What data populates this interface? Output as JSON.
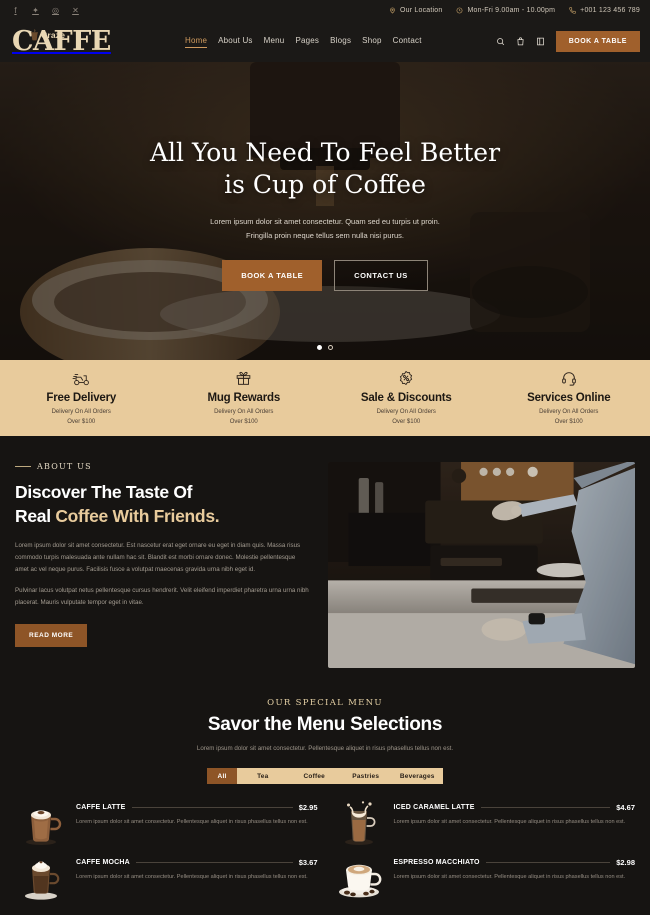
{
  "topbar": {
    "socials": [
      {
        "name": "facebook-icon",
        "glyph": "f"
      },
      {
        "name": "twitter-icon",
        "glyph": "✦"
      },
      {
        "name": "instagram-icon",
        "glyph": "◎"
      },
      {
        "name": "x-icon",
        "glyph": "✕"
      }
    ],
    "location": "Our Location",
    "hours": "Mon-Fri 9.00am - 10.00pm",
    "phone": "+001 123 456 789"
  },
  "header": {
    "logo_main": "AFFE",
    "logo_initial": "C",
    "logo_small": "Craze",
    "nav": [
      {
        "label": "Home",
        "active": true
      },
      {
        "label": "About Us",
        "active": false
      },
      {
        "label": "Menu",
        "active": false
      },
      {
        "label": "Pages",
        "active": false
      },
      {
        "label": "Blogs",
        "active": false
      },
      {
        "label": "Shop",
        "active": false
      },
      {
        "label": "Contact",
        "active": false
      }
    ],
    "book_button": "BOOK A TABLE"
  },
  "hero": {
    "title_line1": "All You Need To Feel Better",
    "title_line2": "is Cup of Coffee",
    "description": "Lorem ipsum dolor sit amet consectetur. Quam sed eu turpis ut proin. Fringilla proin neque tellus sem nulla nisi purus.",
    "primary_button": "BOOK A TABLE",
    "secondary_button": "CONTACT US",
    "slides": 2,
    "active_slide": 1
  },
  "features": [
    {
      "icon": "scooter-delivery-icon",
      "title": "Free Delivery",
      "line1": "Delivery On All Orders",
      "line2": "Over $100"
    },
    {
      "icon": "gift-box-icon",
      "title": "Mug Rewards",
      "line1": "Delivery On All Orders",
      "line2": "Over $100"
    },
    {
      "icon": "discount-badge-icon",
      "title": "Sale & Discounts",
      "line1": "Delivery On All Orders",
      "line2": "Over $100"
    },
    {
      "icon": "headset-icon",
      "title": "Services Online",
      "line1": "Delivery On All Orders",
      "line2": "Over $100"
    }
  ],
  "about": {
    "eyebrow": "ABOUT US",
    "title_line1": "Discover The Taste Of",
    "title_line2_plain": "Real ",
    "title_line2_gold": "Coffee With Friends.",
    "paragraph1": "Lorem ipsum dolor sit amet consectetur. Est nascetur erat eget ornare eu eget in diam quis. Massa risus commodo turpis malesuada ante nullam hac sit. Blandit est morbi ornare donec. Molestie pellentesque amet ac vel neque purus. Facilisis fusce a volutpat maecenas gravida urna nibh eget id.",
    "paragraph2": "Pulvinar lacus volutpat netus pellentesque cursus hendrerit. Velit eleifend imperdiet pharetra urna urna nibh placerat. Mauris vulputate tempor eget in vitae.",
    "read_more": "READ MORE",
    "image_alt": "barista-espresso-machine"
  },
  "menu_section": {
    "eyebrow": "OUR SPECIAL MENU",
    "title": "Savor the Menu Selections",
    "description": "Lorem ipsum dolor sit amet consectetur. Pellentesque aliquet in risus phasellus tellus non est.",
    "tabs": [
      {
        "label": "All",
        "active": true
      },
      {
        "label": "Tea",
        "active": false
      },
      {
        "label": "Coffee",
        "active": false
      },
      {
        "label": "Pastries",
        "active": false
      },
      {
        "label": "Beverages",
        "active": false
      }
    ],
    "items": [
      {
        "name": "CAFFE LATTE",
        "price": "$2.95",
        "desc": "Lorem ipsum dolor sit amet consectetur. Pellentesque aliquet in risus phasellus tellus non est.",
        "thumb": "latte-glass-mug"
      },
      {
        "name": "ICED CARAMEL LATTE",
        "price": "$4.67",
        "desc": "Lorem ipsum dolor sit amet consectetur. Pellentesque aliquet in risus phasellus tellus non est.",
        "thumb": "iced-caramel-splash"
      },
      {
        "name": "CAFFE MOCHA",
        "price": "$3.67",
        "desc": "Lorem ipsum dolor sit amet consectetur. Pellentesque aliquet in risus phasellus tellus non est.",
        "thumb": "mocha-glass-cup"
      },
      {
        "name": "ESPRESSO MACCHIATO",
        "price": "$2.98",
        "desc": "Lorem ipsum dolor sit amet consectetur. Pellentesque aliquet in risus phasellus tellus non est.",
        "thumb": "espresso-cup-beans"
      }
    ]
  },
  "colors": {
    "accent_brown": "#a0602c",
    "dark_brown": "#8e5527",
    "beige": "#e8cb9c",
    "gold_text": "#e8cb9c",
    "dark_bg": "#161412",
    "header_bg": "#1b1917"
  }
}
